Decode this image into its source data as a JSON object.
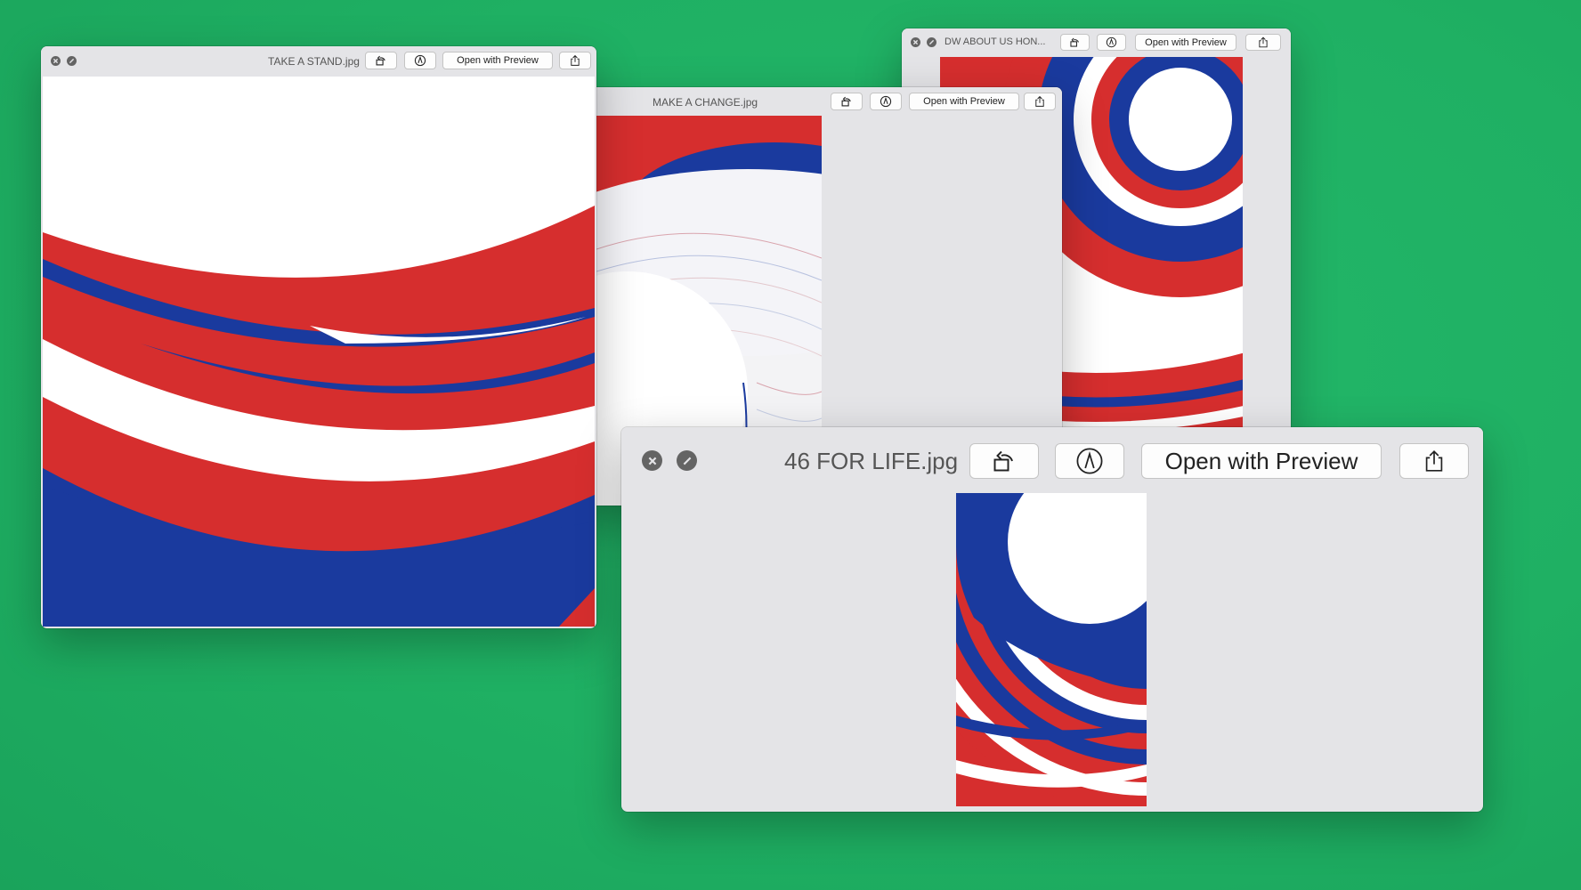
{
  "windows": {
    "dw": {
      "title": "DW ABOUT US HON...",
      "open_label": "Open with Preview"
    },
    "change": {
      "title": "MAKE A CHANGE.jpg",
      "open_label": "Open with Preview"
    },
    "stand": {
      "title": "TAKE A STAND.jpg",
      "open_label": "Open with Preview"
    },
    "life": {
      "title": "46 FOR LIFE.jpg",
      "open_label": "Open with Preview"
    }
  },
  "colors": {
    "background": "#1fb063",
    "red": "#d62e2e",
    "blue": "#1a3a9e",
    "white": "#ffffff",
    "window": "#e4e4e7"
  },
  "icons": [
    "close-icon",
    "full-screen-icon",
    "rotate-icon",
    "markup-icon",
    "share-icon"
  ]
}
